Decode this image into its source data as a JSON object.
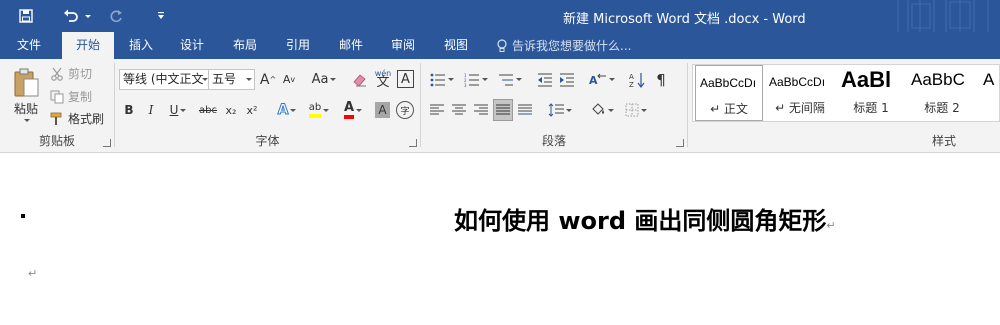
{
  "titlebar": {
    "title": "新建 Microsoft Word 文档 .docx - Word"
  },
  "tabs": [
    {
      "label": "文件",
      "active": false
    },
    {
      "label": "开始",
      "active": true
    },
    {
      "label": "插入",
      "active": false
    },
    {
      "label": "设计",
      "active": false
    },
    {
      "label": "布局",
      "active": false
    },
    {
      "label": "引用",
      "active": false
    },
    {
      "label": "邮件",
      "active": false
    },
    {
      "label": "审阅",
      "active": false
    },
    {
      "label": "视图",
      "active": false
    }
  ],
  "tell_me": {
    "placeholder": "告诉我您想要做什么..."
  },
  "clipboard": {
    "paste_label": "粘贴",
    "cut_label": "剪切",
    "copy_label": "复制",
    "format_painter_label": "格式刷",
    "group_label": "剪贴板"
  },
  "font": {
    "font_name": "等线 (中文正文",
    "font_size": "五号",
    "grow_label": "A",
    "shrink_label": "A",
    "change_case_label": "Aa",
    "phonetic_label": "wén",
    "phonetic_char": "文",
    "border_char": "A",
    "bold_label": "B",
    "italic_label": "I",
    "underline_label": "U",
    "strike_label": "abc",
    "subscript_label": "x₂",
    "superscript_label": "x²",
    "effects_label": "A",
    "highlight_label": "ab",
    "color_label": "A",
    "shading_label": "A",
    "enclose_label": "字",
    "group_label": "字体"
  },
  "paragraph": {
    "group_label": "段落"
  },
  "styles": {
    "items": [
      {
        "sample": "AaBbCcDı",
        "name": "↵ 正文"
      },
      {
        "sample": "AaBbCcDı",
        "name": "↵ 无间隔"
      },
      {
        "sample": "AaBl",
        "name": "标题 1"
      },
      {
        "sample": "AaBbC",
        "name": "标题 2"
      }
    ],
    "group_label": "样式"
  },
  "document": {
    "heading": "如何使用 word 画出同侧圆角矩形",
    "paragraph_mark": "↵"
  },
  "colors": {
    "brand": "#2b579a",
    "ribbon_bg": "#f3f3f3",
    "highlight_yellow": "#ffff00",
    "font_red": "#ff0000"
  }
}
